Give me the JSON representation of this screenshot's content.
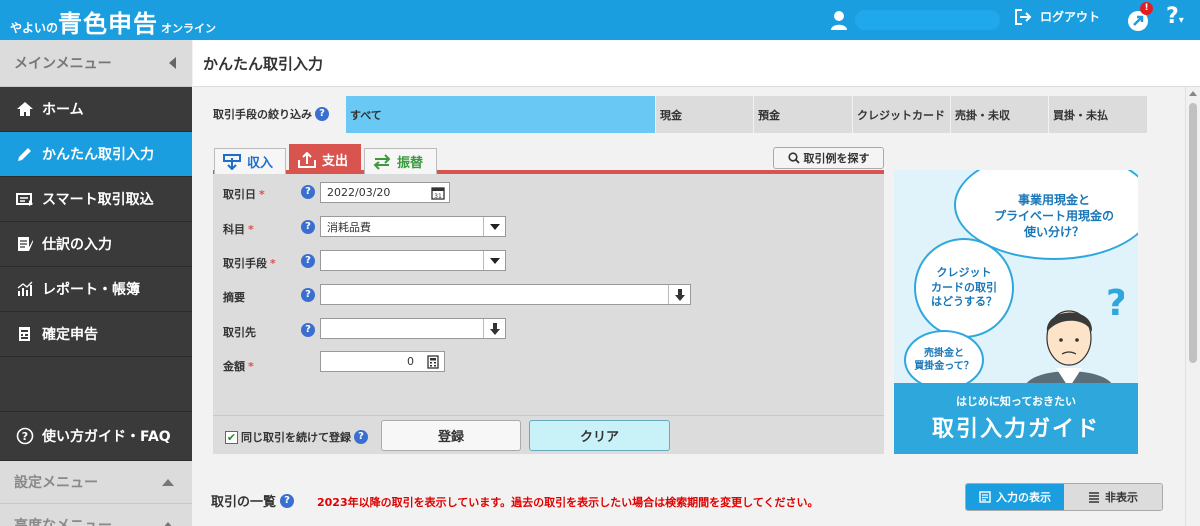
{
  "header": {
    "logo_prefix": "やよいの",
    "logo_main": "青色申告",
    "logo_suffix": "オンライン",
    "logout_label": "ログアウト",
    "notification_badge": "!",
    "help_label": "?"
  },
  "sidebar": {
    "heading": "メインメニュー",
    "items": [
      {
        "label": "ホーム",
        "icon": "home-icon"
      },
      {
        "label": "かんたん取引入力",
        "icon": "pencil-icon"
      },
      {
        "label": "スマート取引取込",
        "icon": "import-icon"
      },
      {
        "label": "仕訳の入力",
        "icon": "journal-icon"
      },
      {
        "label": "レポート・帳簿",
        "icon": "report-icon"
      },
      {
        "label": "確定申告",
        "icon": "tax-return-icon"
      }
    ],
    "guide": "使い方ガイド・FAQ",
    "settings_menu": "設定メニュー",
    "advanced_menu": "高度なメニュー"
  },
  "page": {
    "title": "かんたん取引入力"
  },
  "filter": {
    "label": "取引手段の絞り込み",
    "tabs": [
      "すべて",
      "現金",
      "預金",
      "クレジットカード",
      "売掛・未収",
      "買掛・未払"
    ],
    "selected": "すべて"
  },
  "type_tabs": {
    "income": "収入",
    "expense": "支出",
    "transfer": "振替"
  },
  "examples_button": "取引例を探す",
  "form": {
    "date_label": "取引日",
    "date_value": "2022/03/20",
    "account_label": "科目",
    "account_value": "消耗品費",
    "method_label": "取引手段",
    "method_value": "",
    "memo_label": "摘要",
    "memo_value": "",
    "partner_label": "取引先",
    "partner_value": "",
    "amount_label": "金額",
    "amount_value": "0",
    "required_mark": "*",
    "continue_label": "同じ取引を続けて登録",
    "register_button": "登録",
    "clear_button": "クリア"
  },
  "ad": {
    "bubble1": "事業用現金と\nプライベート用現金の\n使い分け？",
    "bubble2": "クレジット\nカードの取引\nはどうする？",
    "bubble3": "売掛金と\n買掛金って？",
    "sub": "はじめに知っておきたい",
    "main": "取引入力ガイド",
    "accent": "#2ea8dc"
  },
  "list": {
    "title": "取引の一覧",
    "note": "2023年以降の取引を表示しています。過去の取引を表示したい場合は検索期間を変更してください。",
    "show_input": "入力の表示",
    "hide": "非表示"
  },
  "colors": {
    "brand_blue": "#1a9ee0",
    "expense_red": "#d9534f",
    "filter_selected": "#6ac8f5"
  }
}
